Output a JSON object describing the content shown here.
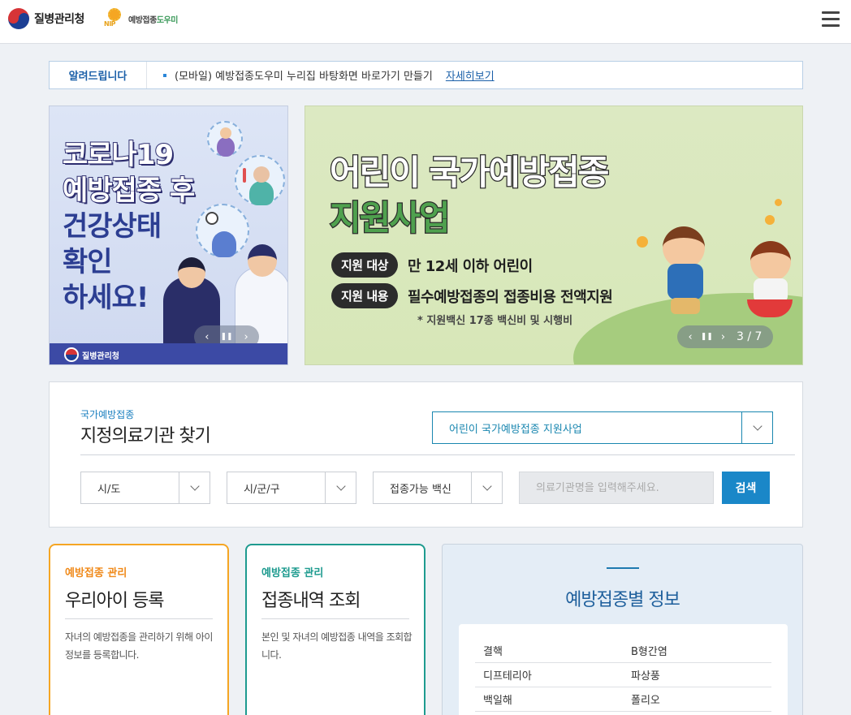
{
  "header": {
    "org_name": "질병관리청",
    "site_name_a": "예방접종",
    "site_name_b": "도우미",
    "site_mark": "NIP",
    "menu_icon": "hamburger-icon"
  },
  "notice": {
    "label": "알려드립니다",
    "text": "(모바일) 예방접종도우미 누리집 바탕화면 바로가기 만들기",
    "more_link": "자세히보기"
  },
  "banner_left": {
    "line1": "코로나19",
    "line2": "예방접종 후",
    "line3": "건강상태",
    "line4": "확인",
    "line5": "하세요!",
    "footer_org": "질병관리청",
    "prev": "‹",
    "pause": "❚❚",
    "next": "›"
  },
  "banner_right": {
    "title1": "어린이 국가예방접종",
    "title2": "지원사업",
    "target_label": "지원 대상",
    "target_value": "만 12세 이하 어린이",
    "content_label": "지원 내용",
    "content_value": "필수예방접종의 접종비용 전액지원",
    "note": "* 지원백신 17종 백신비 및 시행비",
    "prev": "‹",
    "pause": "❚❚",
    "next": "›",
    "page_indicator": "3 / 7"
  },
  "search": {
    "subtitle": "국가예방접종",
    "title": "지정의료기관 찾기",
    "program_selected": "어린이 국가예방접종 지원사업",
    "sido": "시/도",
    "sigungu": "시/군/구",
    "vaccine": "접종가능 백신",
    "name_placeholder": "의료기관명을 입력해주세요.",
    "search_button": "검색"
  },
  "cards": {
    "register": {
      "subtitle": "예방접종 관리",
      "title": "우리아이 등록",
      "desc": "자녀의 예방접종을 관리하기 위해 아이 정보를 등록합니다."
    },
    "history": {
      "subtitle": "예방접종 관리",
      "title": "접종내역 조회",
      "desc": "본인 및 자녀의 예방접종 내역을 조회합니다."
    }
  },
  "info": {
    "title": "예방접종별 정보",
    "rows": [
      [
        "결핵",
        "B형간염"
      ],
      [
        "디프테리아",
        "파상풍"
      ],
      [
        "백일해",
        "폴리오"
      ]
    ]
  }
}
